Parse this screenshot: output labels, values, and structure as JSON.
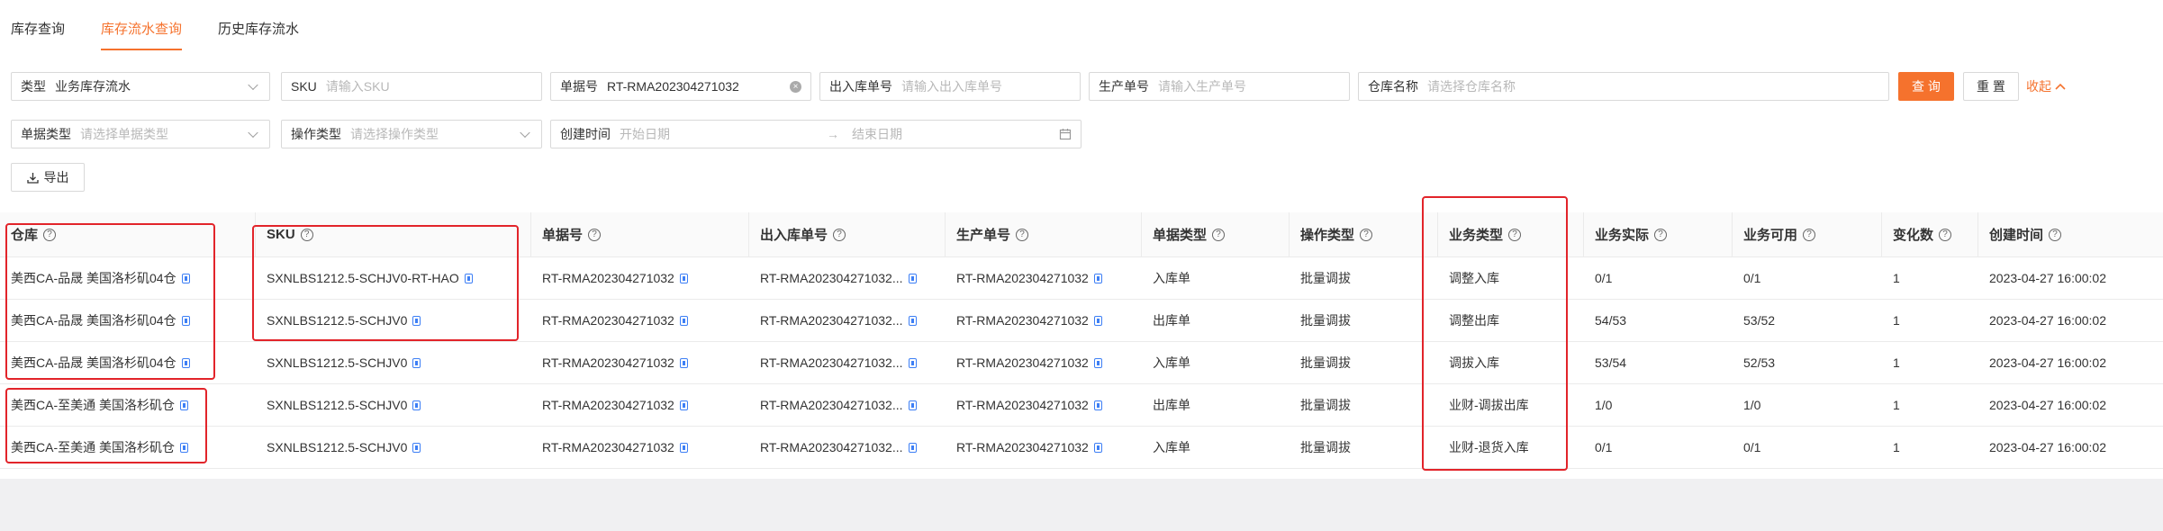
{
  "tabs": [
    "库存查询",
    "库存流水查询",
    "历史库存流水"
  ],
  "filters": {
    "type": {
      "label": "类型",
      "value": "业务库存流水"
    },
    "sku": {
      "label": "SKU",
      "placeholder": "请输入SKU"
    },
    "order_no": {
      "label": "单据号",
      "value": "RT-RMA202304271032"
    },
    "io_no": {
      "label": "出入库单号",
      "placeholder": "请输入出入库单号"
    },
    "prod_no": {
      "label": "生产单号",
      "placeholder": "请输入生产单号"
    },
    "warehouse": {
      "label": "仓库名称",
      "placeholder": "请选择仓库名称"
    },
    "doc_type": {
      "label": "单据类型",
      "placeholder": "请选择单据类型"
    },
    "op_type": {
      "label": "操作类型",
      "placeholder": "请选择操作类型"
    },
    "created": {
      "label": "创建时间",
      "start_placeholder": "开始日期",
      "end_placeholder": "结束日期"
    }
  },
  "buttons": {
    "query": "查 询",
    "reset": "重 置",
    "collapse": "收起",
    "export": "导出"
  },
  "table": {
    "columns": [
      "仓库",
      "SKU",
      "单据号",
      "出入库单号",
      "生产单号",
      "单据类型",
      "操作类型",
      "业务类型",
      "业务实际",
      "业务可用",
      "变化数",
      "创建时间"
    ],
    "rows": [
      [
        "美西CA-品晟 美国洛杉矶04仓",
        "SXNLBS1212.5-SCHJV0-RT-HAO",
        "RT-RMA202304271032",
        "RT-RMA202304271032...",
        "RT-RMA202304271032",
        "入库单",
        "批量调拔",
        "调整入库",
        "0/1",
        "0/1",
        "1",
        "2023-04-27 16:00:02"
      ],
      [
        "美西CA-品晟 美国洛杉矶04仓",
        "SXNLBS1212.5-SCHJV0",
        "RT-RMA202304271032",
        "RT-RMA202304271032...",
        "RT-RMA202304271032",
        "出库单",
        "批量调拔",
        "调整出库",
        "54/53",
        "53/52",
        "1",
        "2023-04-27 16:00:02"
      ],
      [
        "美西CA-品晟 美国洛杉矶04仓",
        "SXNLBS1212.5-SCHJV0",
        "RT-RMA202304271032",
        "RT-RMA202304271032...",
        "RT-RMA202304271032",
        "入库单",
        "批量调拔",
        "调拔入库",
        "53/54",
        "52/53",
        "1",
        "2023-04-27 16:00:02"
      ],
      [
        "美西CA-至美通 美国洛杉矶仓",
        "SXNLBS1212.5-SCHJV0",
        "RT-RMA202304271032",
        "RT-RMA202304271032...",
        "RT-RMA202304271032",
        "出库单",
        "批量调拔",
        "业财-调拔出库",
        "1/0",
        "1/0",
        "1",
        "2023-04-27 16:00:02"
      ],
      [
        "美西CA-至美通 美国洛杉矶仓",
        "SXNLBS1212.5-SCHJV0",
        "RT-RMA202304271032",
        "RT-RMA202304271032...",
        "RT-RMA202304271032",
        "入库单",
        "批量调拔",
        "业财-退货入库",
        "0/1",
        "0/1",
        "1",
        "2023-04-27 16:00:02"
      ]
    ]
  },
  "colors": {
    "accent": "#f5722d",
    "highlight_box": "#e2242a",
    "copy_icon": "#3d7ff5"
  }
}
